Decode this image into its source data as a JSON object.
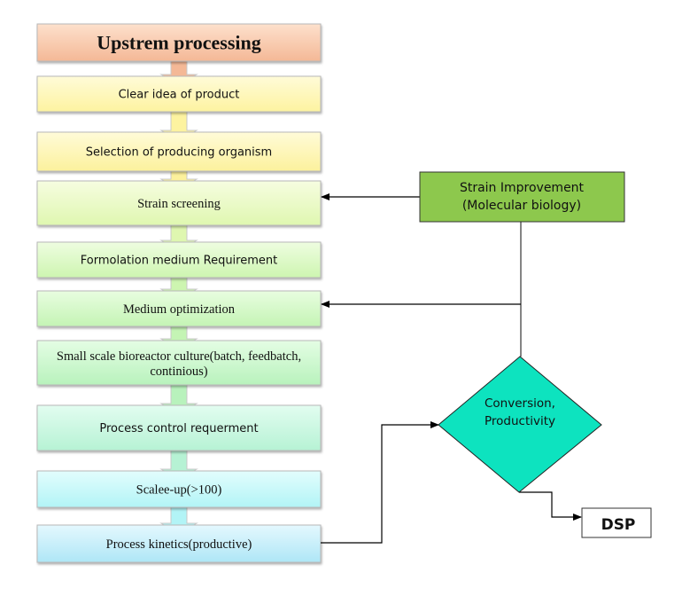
{
  "steps": [
    {
      "label": "Upstrem processing",
      "color_top": "#fde0cc",
      "color_bottom": "#f4b896"
    },
    {
      "label": "Clear idea of product",
      "color_top": "#fffbd8",
      "color_bottom": "#fdf3a0"
    },
    {
      "label": "Selection of producing organism",
      "color_top": "#fffbd8",
      "color_bottom": "#fcf19c"
    },
    {
      "label": "Strain screening",
      "color_top": "#f6fde0",
      "color_bottom": "#dff7b0"
    },
    {
      "label": "Formolation medium Requirement",
      "color_top": "#eefde0",
      "color_bottom": "#cdf5b0"
    },
    {
      "label": "Medium optimization",
      "color_top": "#e8fde0",
      "color_bottom": "#c4f4b4"
    },
    {
      "label": "Small scale bioreactor culture(batch, feedbatch,",
      "label2": "continious)",
      "color_top": "#e4fde4",
      "color_bottom": "#b8f2bc"
    },
    {
      "label": "Process control requerment",
      "color_top": "#e2fdf0",
      "color_bottom": "#b6f2d4"
    },
    {
      "label": "Scalee-up(>100)",
      "color_top": "#e2fdfd",
      "color_bottom": "#b2f4f6"
    },
    {
      "label": "Process kinetics(productive)",
      "color_top": "#e4f8fe",
      "color_bottom": "#aee6f6"
    }
  ],
  "strain_improvement": {
    "line1": "Strain Improvement",
    "line2": "(Molecular biology)",
    "color": "#8dc84d"
  },
  "decision": {
    "line1": "Conversion,",
    "line2": "Productivity",
    "color": "#0de3bf"
  },
  "dsp": {
    "label": "DSP"
  }
}
